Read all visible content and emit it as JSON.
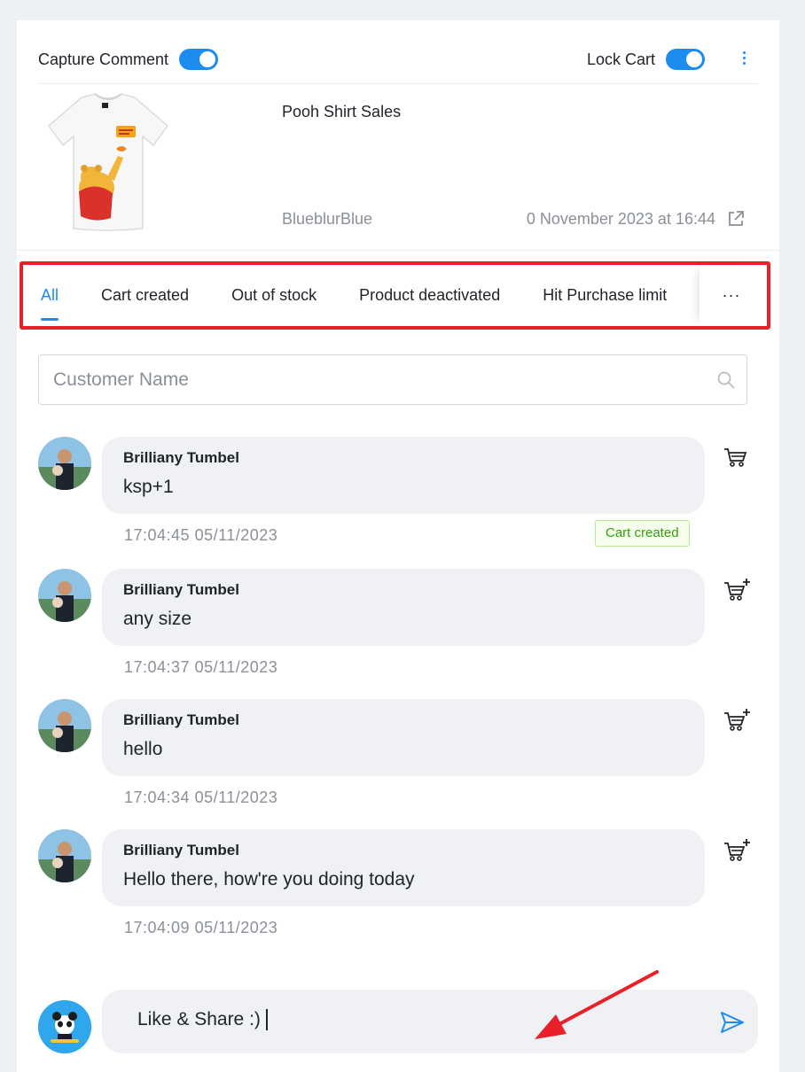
{
  "header": {
    "capture_comment_label": "Capture Comment",
    "capture_comment_on": true,
    "lock_cart_label": "Lock Cart",
    "lock_cart_on": true
  },
  "product": {
    "name": "Pooh Shirt Sales",
    "seller": "BlueblurBlue",
    "posted_at": "0 November 2023 at 16:44"
  },
  "tabs": {
    "items": [
      {
        "label": "All",
        "active": true
      },
      {
        "label": "Cart created",
        "active": false
      },
      {
        "label": "Out of stock",
        "active": false
      },
      {
        "label": "Product deactivated",
        "active": false
      },
      {
        "label": "Hit Purchase limit",
        "active": false
      }
    ],
    "more_label": "···"
  },
  "search": {
    "placeholder": "Customer Name"
  },
  "comments": [
    {
      "author": "Brilliany Tumbel",
      "text": "ksp+1",
      "time": "17:04:45 05/11/2023",
      "badge": "Cart created",
      "icon": "cart-icon"
    },
    {
      "author": "Brilliany Tumbel",
      "text": "any size",
      "time": "17:04:37 05/11/2023",
      "icon": "add-to-cart-icon"
    },
    {
      "author": "Brilliany Tumbel",
      "text": "hello",
      "time": "17:04:34 05/11/2023",
      "icon": "add-to-cart-icon"
    },
    {
      "author": "Brilliany Tumbel",
      "text": "Hello there, how're you doing today",
      "time": "17:04:09 05/11/2023",
      "icon": "add-to-cart-icon"
    }
  ],
  "composer": {
    "value": "Like & Share :)"
  },
  "colors": {
    "accent": "#1d8cf0",
    "highlight_box": "#e8202a",
    "badge_green": "#389e0d"
  }
}
